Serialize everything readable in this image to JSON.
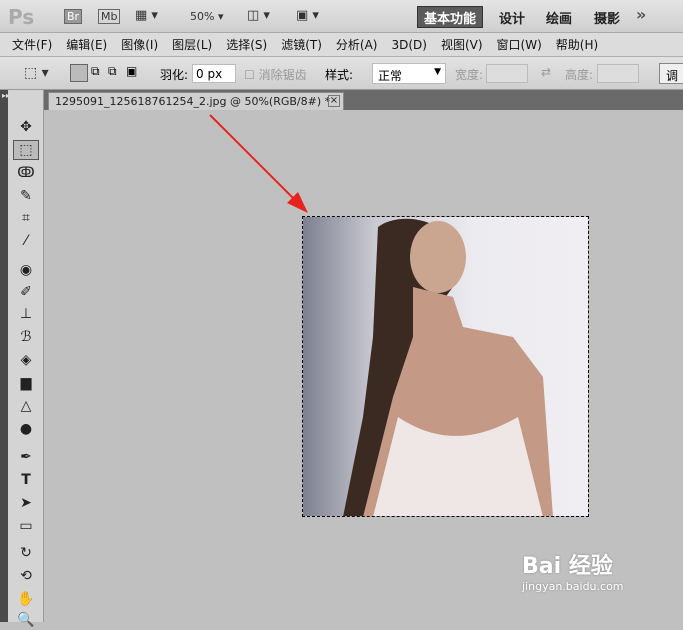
{
  "appbar": {
    "logo": "Ps",
    "br": "Br",
    "mb": "Mb",
    "zoom": "50%",
    "workspaces": [
      "基本功能",
      "设计",
      "绘画",
      "摄影"
    ],
    "more": "»"
  },
  "menu": [
    "文件(F)",
    "编辑(E)",
    "图像(I)",
    "图层(L)",
    "选择(S)",
    "滤镜(T)",
    "分析(A)",
    "3D(D)",
    "视图(V)",
    "窗口(W)",
    "帮助(H)"
  ],
  "options": {
    "feather_label": "羽化:",
    "feather_value": "0 px",
    "antialias_label": "消除锯齿",
    "style_label": "样式:",
    "style_value": "正常",
    "width_label": "宽度:",
    "height_label": "高度:",
    "adjust_label": "调"
  },
  "document": {
    "tab_title": "1295091_125618761254_2.jpg @ 50%(RGB/8#) *",
    "close": "×"
  },
  "toolbox": {
    "collapse": "▸▸",
    "tools": [
      "move",
      "rect-marquee",
      "lasso",
      "quick-select",
      "crop",
      "eyedropper",
      "spot-heal",
      "brush",
      "clone-stamp",
      "history-brush",
      "eraser",
      "gradient",
      "blur",
      "dodge",
      "pen",
      "type",
      "path-select",
      "shape",
      "3d-rotate",
      "3d-orbit",
      "hand",
      "zoom"
    ]
  },
  "watermark": {
    "brand": "Bai 经验",
    "url": "jingyan.baidu.com"
  },
  "colors": {
    "arrow": "#e8231d",
    "accent": "#5a5a5a"
  }
}
